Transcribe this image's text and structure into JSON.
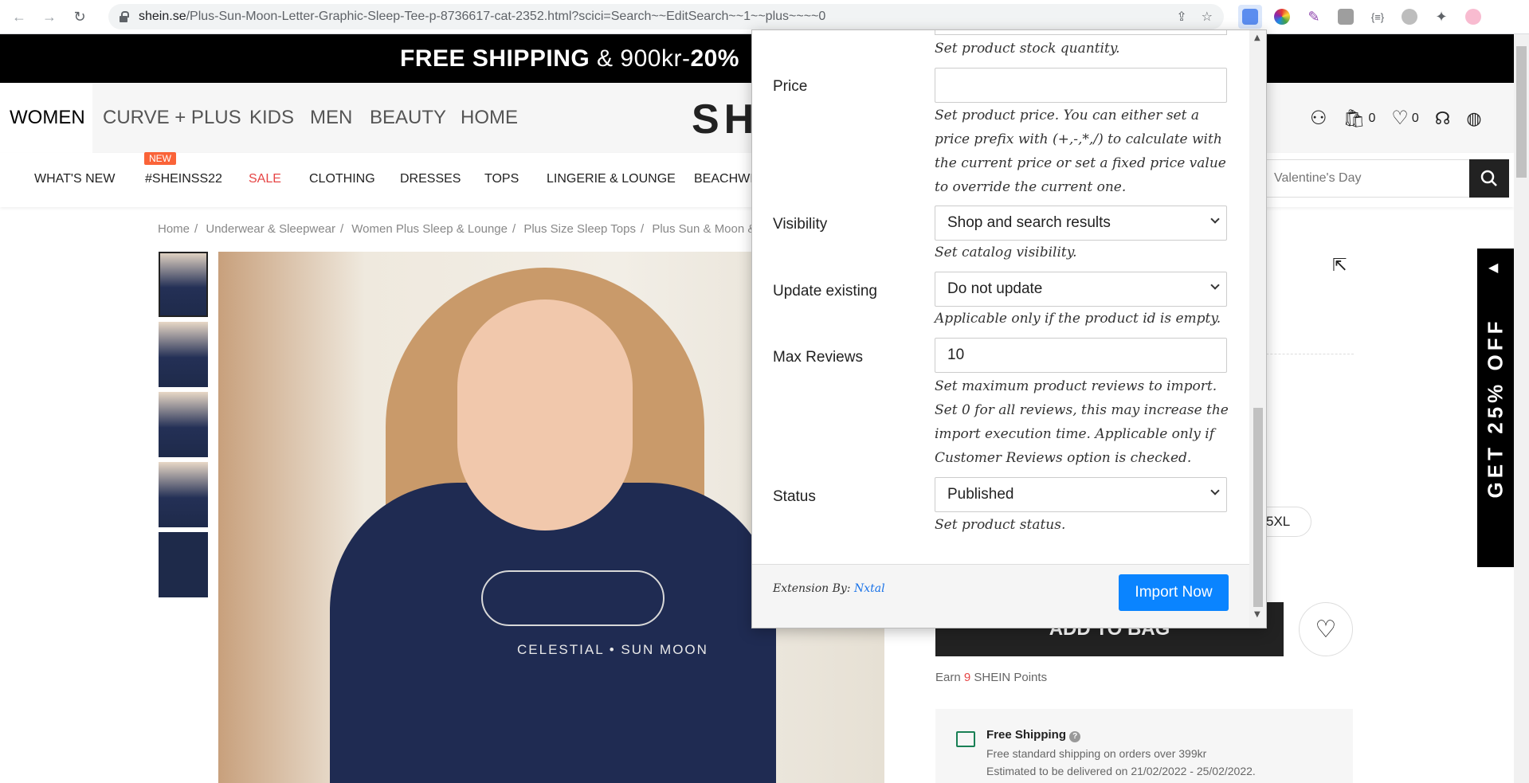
{
  "browser": {
    "url_host": "shein.se",
    "url_path": "/Plus-Sun-Moon-Letter-Graphic-Sleep-Tee-p-8736617-cat-2352.html?scici=Search~~EditSearch~~1~~plus~~~~0",
    "back_icon": "arrow-left-icon",
    "forward_icon": "arrow-right-icon",
    "reload_icon": "reload-icon",
    "ext_label": "{≡}"
  },
  "promo": {
    "bold1": "FREE SHIPPING",
    "mid": " & 900kr-",
    "bold2": "20%"
  },
  "categories": [
    "WOMEN",
    "CURVE + PLUS",
    "KIDS",
    "MEN",
    "BEAUTY",
    "HOME"
  ],
  "logo": "SH",
  "header": {
    "bag_count": "0",
    "wish_count": "0"
  },
  "subnav": [
    "WHAT'S NEW",
    "#SHEINSS22",
    "SALE",
    "CLOTHING",
    "DRESSES",
    "TOPS",
    "LINGERIE & LOUNGE",
    "BEACHWI"
  ],
  "new_badge": "NEW",
  "search": {
    "placeholder": "Valentine's Day"
  },
  "breadcrumb": [
    "Home",
    "Underwear & Sleepwear",
    "Women Plus Sleep & Lounge",
    "Plus Size Sleep Tops",
    "Plus Sun & Moon &"
  ],
  "product": {
    "shirt_text": "CELESTIAL • SUN MOON",
    "size": "5XL",
    "add_to_bag": "ADD TO BAG",
    "points_prefix": "Earn ",
    "points_value": "9",
    "points_suffix": " SHEIN Points",
    "shipping_title": "Free Shipping",
    "shipping_line1": "Free standard shipping on orders over 399kr",
    "shipping_line2": "Estimated to be delivered on 21/02/2022 - 25/02/2022."
  },
  "side_promo": "GET 25% OFF",
  "popup": {
    "stock_help": "Set product stock quantity.",
    "price_label": "Price",
    "price_value": "",
    "price_help": "Set product price. You can either set a price prefix with (+,-,*,/) to calculate with the current price or set a fixed price value to override the current one.",
    "visibility_label": "Visibility",
    "visibility_value": "Shop and search results",
    "visibility_help": "Set catalog visibility.",
    "update_label": "Update existing",
    "update_value": "Do not update",
    "update_help": "Applicable only if the product id is empty.",
    "reviews_label": "Max Reviews",
    "reviews_value": "10",
    "reviews_help": "Set maximum product reviews to import. Set 0 for all reviews, this may increase the import execution time. Applicable only if Customer Reviews option is checked.",
    "status_label": "Status",
    "status_value": "Published",
    "status_help": "Set product status.",
    "footer_prefix": "Extension By: ",
    "footer_link": "Nxtal",
    "import_button": "Import Now"
  }
}
